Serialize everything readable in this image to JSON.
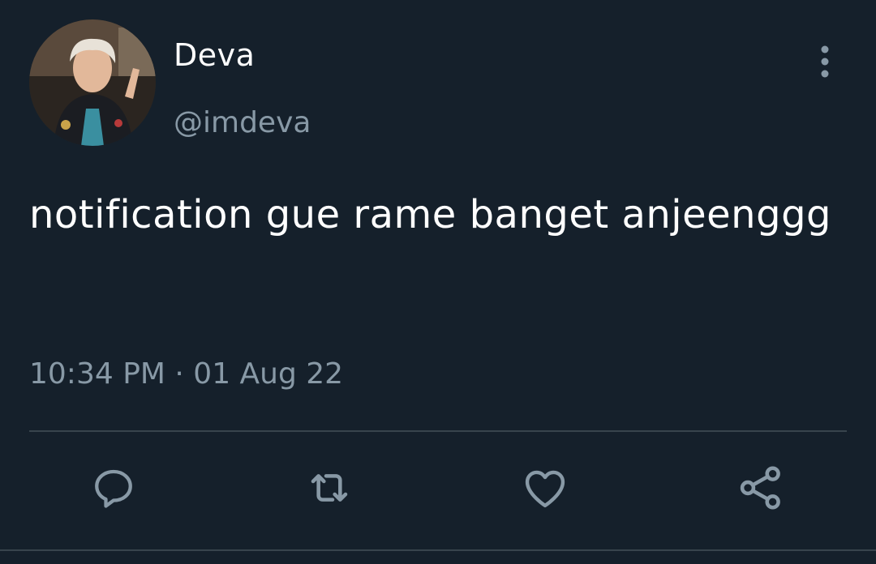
{
  "tweet": {
    "author_name": "Deva",
    "author_handle": "@imdeva",
    "text": "notification gue rame banget anjeenggg",
    "timestamp": "10:34 PM · 01 Aug 22"
  },
  "icons": {
    "more": "more-vertical-icon",
    "reply": "reply-icon",
    "retweet": "retweet-icon",
    "like": "heart-icon",
    "share": "share-icon"
  },
  "colors": {
    "background": "#15202b",
    "primary_text": "#ffffff",
    "secondary_text": "#8899a6",
    "divider": "#38444d"
  }
}
